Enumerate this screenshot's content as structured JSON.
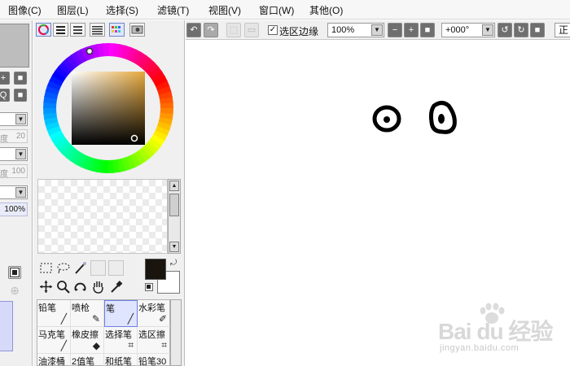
{
  "menu": {
    "items": [
      "图像(C)",
      "图层(L)",
      "选择(S)",
      "滤镜(T)",
      "视图(V)",
      "窗口(W)",
      "其他(O)"
    ]
  },
  "left_strip": {
    "field_density_label": "度",
    "field_density_value": "20",
    "field_min_label": "度",
    "field_min_value": "100",
    "opacity_value": "100%"
  },
  "color_panel": {
    "modes": [
      "color-wheel-icon",
      "rgb-slider-icon",
      "hsv-slider-icon",
      "palette-icon",
      "swatches-icon",
      "scratchpad-icon"
    ],
    "hue_color": "#e6a83b",
    "foreground_color": "#1a140f",
    "background_color": "#ffffff"
  },
  "tools": [
    "rect-select-icon",
    "lasso-icon",
    "magic-wand-icon",
    "move-icon",
    "zoom-icon",
    "rotate-icon",
    "hand-icon",
    "eyedropper-icon"
  ],
  "brushes": [
    {
      "name": "铅笔",
      "icon": "pencil-icon"
    },
    {
      "name": "喷枪",
      "icon": "airbrush-icon"
    },
    {
      "name": "笔",
      "icon": "pen-icon",
      "active": true
    },
    {
      "name": "水彩笔",
      "icon": "watercolor-icon"
    },
    {
      "name": "马克笔",
      "icon": "marker-icon"
    },
    {
      "name": "橡皮擦",
      "icon": "eraser-icon"
    },
    {
      "name": "选择笔",
      "icon": "select-pen-icon"
    },
    {
      "name": "选区擦",
      "icon": "select-eraser-icon"
    },
    {
      "name": "油漆桶",
      "icon": "bucket-icon"
    },
    {
      "name": "2值笔",
      "icon": "binary-pen-icon"
    },
    {
      "name": "和纸笔",
      "icon": "washi-pen-icon"
    },
    {
      "name": "铅笔30",
      "icon": "pencil30-icon"
    }
  ],
  "toolbar": {
    "selection_edge_label": "选区边缘",
    "selection_edge_checked": true,
    "zoom_value": "100%",
    "rotation_value": "+000°",
    "cut_label": "正"
  },
  "watermark": {
    "brand": "Bai du 经验",
    "site": "jingyan.baidu.com"
  }
}
